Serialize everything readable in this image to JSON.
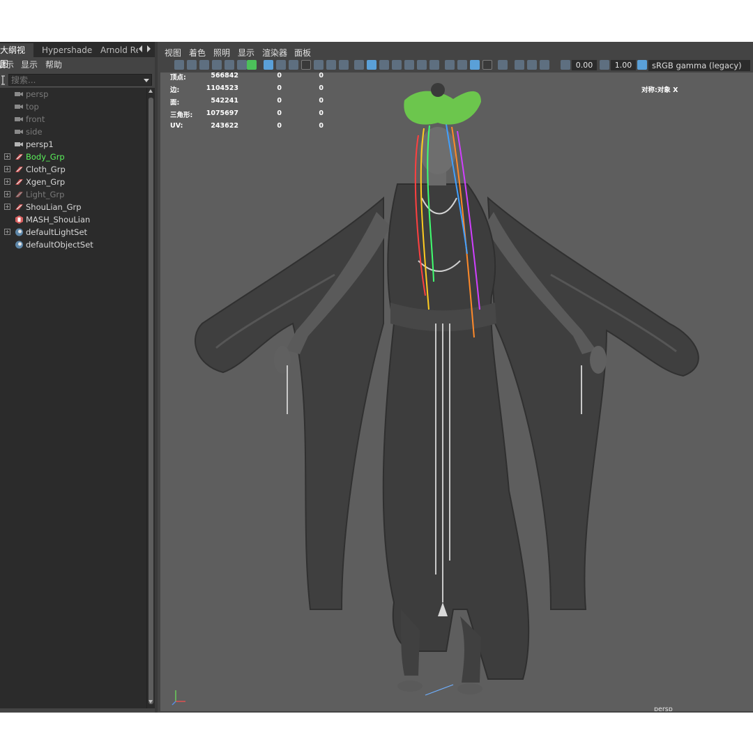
{
  "outliner": {
    "tabs": [
      "大纲视图",
      "Hypershade",
      "Arnold Re"
    ],
    "menu": [
      "展示",
      "显示",
      "帮助"
    ],
    "search_placeholder": "搜索...",
    "items": [
      {
        "label": "persp",
        "type": "camera",
        "dim": true
      },
      {
        "label": "top",
        "type": "camera",
        "dim": true
      },
      {
        "label": "front",
        "type": "camera",
        "dim": true
      },
      {
        "label": "side",
        "type": "camera",
        "dim": true
      },
      {
        "label": "persp1",
        "type": "camera",
        "dim": false
      },
      {
        "label": "Body_Grp",
        "type": "group",
        "selected": true
      },
      {
        "label": "Cloth_Grp",
        "type": "group"
      },
      {
        "label": "Xgen_Grp",
        "type": "group"
      },
      {
        "label": "Light_Grp",
        "type": "group",
        "dim": true
      },
      {
        "label": "ShouLian_Grp",
        "type": "group"
      },
      {
        "label": "MASH_ShouLian",
        "type": "mash"
      },
      {
        "label": "defaultLightSet",
        "type": "set"
      },
      {
        "label": "defaultObjectSet",
        "type": "set"
      }
    ],
    "selected_color": "#5af05a"
  },
  "viewport": {
    "menu": [
      "视图",
      "着色",
      "照明",
      "显示",
      "渲染器",
      "面板"
    ],
    "exposure": "0.00",
    "gamma": "1.00",
    "color_space": "sRGB gamma (legacy)",
    "camera_label": "persp",
    "symmetry": "对称:对象 X",
    "hud": [
      {
        "label": "顶点:",
        "v1": "566842",
        "v2": "0",
        "v3": "0"
      },
      {
        "label": "边:",
        "v1": "1104523",
        "v2": "0",
        "v3": "0"
      },
      {
        "label": "面:",
        "v1": "542241",
        "v2": "0",
        "v3": "0"
      },
      {
        "label": "三角形:",
        "v1": "1075697",
        "v2": "0",
        "v3": "0"
      },
      {
        "label": "UV:",
        "v1": "243622",
        "v2": "0",
        "v3": "0"
      }
    ],
    "background_color": "#5e5e5e"
  }
}
